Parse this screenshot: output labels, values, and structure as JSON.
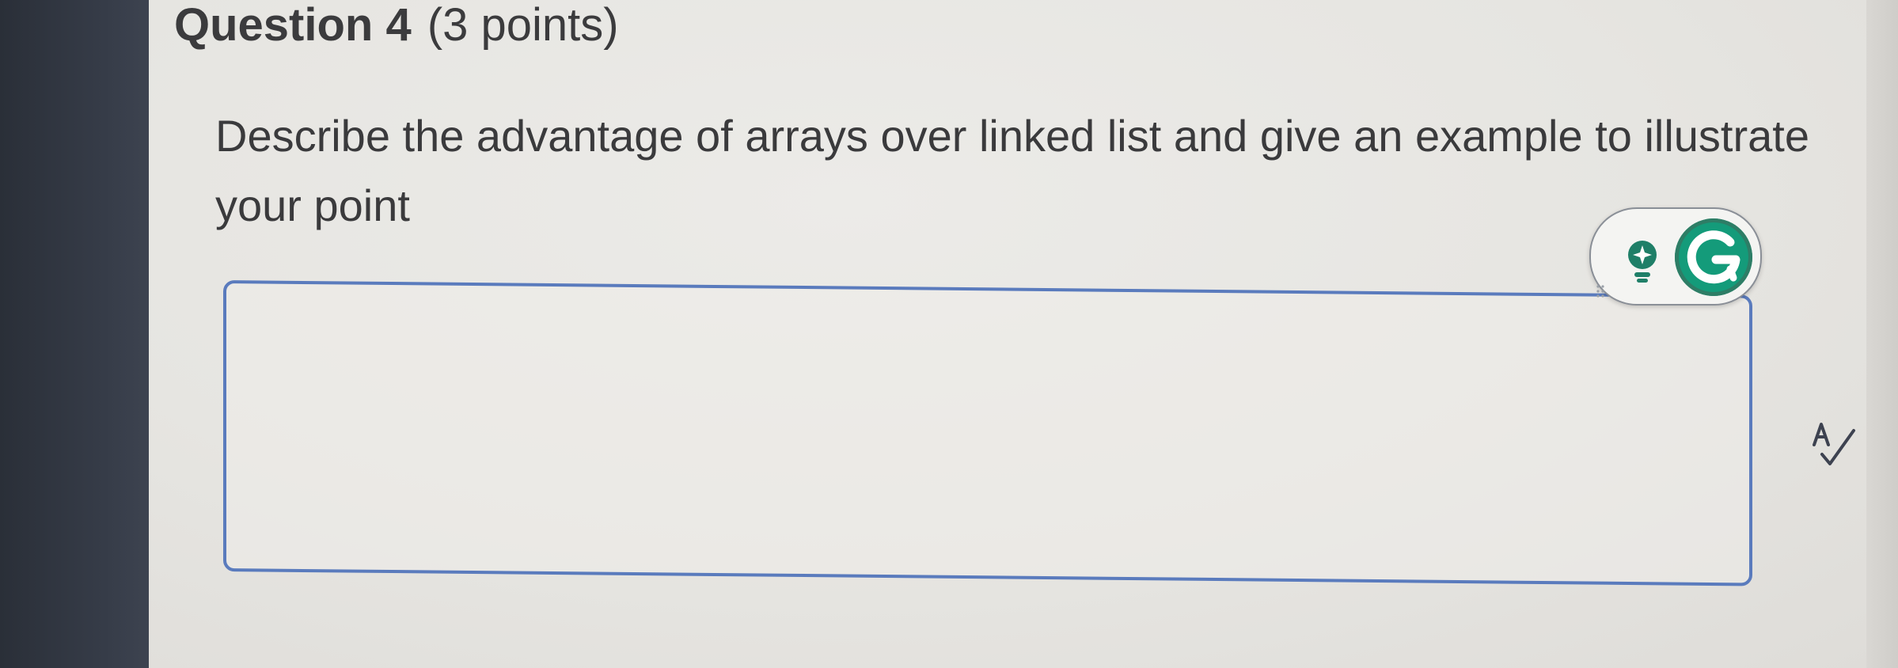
{
  "question": {
    "title": "Question 4",
    "points": "(3 points)",
    "prompt": "Describe the advantage of arrays over linked list and give an example to illustrate your point"
  },
  "answer": {
    "value": ""
  },
  "grammarly": {
    "brand_letter": "G",
    "brand_color": "#149b7a",
    "suggestion_icon": "lightbulb-icon"
  },
  "spellcheck": {
    "icon": "spellcheck-icon"
  },
  "colors": {
    "box_border": "#5a7bbd",
    "text": "#3a3a3c",
    "sidebar": "#2f3440"
  }
}
